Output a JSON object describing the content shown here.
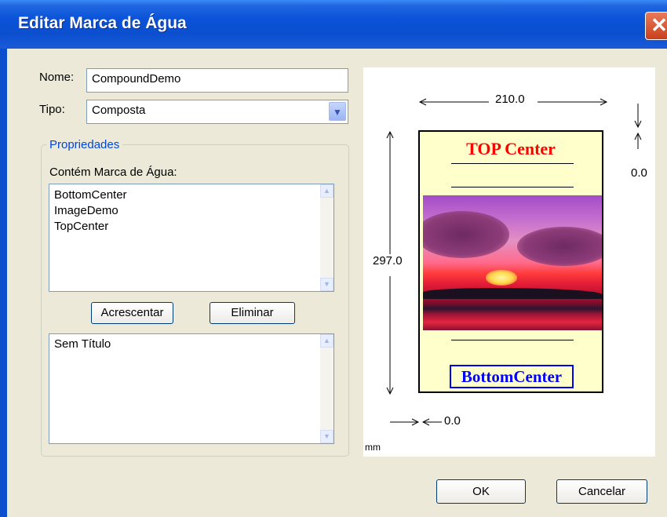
{
  "window": {
    "title": "Editar Marca de Água",
    "close_icon": "close-icon"
  },
  "form": {
    "nome_label": "Nome:",
    "nome_value": "CompoundDemo",
    "tipo_label": "Tipo:",
    "tipo_value": "Composta"
  },
  "properties": {
    "legend": "Propriedades",
    "contains_label": "Contém Marca de Água:",
    "watermarks": [
      "BottomCenter",
      "ImageDemo",
      "TopCenter"
    ],
    "add_button": "Acrescentar",
    "remove_button": "Eliminar",
    "detail_text": "Sem Título"
  },
  "preview": {
    "width_label": "210.0",
    "height_label": "297.0",
    "top_offset_label": "0.0",
    "left_offset_label": "0.0",
    "units_label": "mm",
    "top_text": "TOP Center",
    "bottom_text": "BottomCenter",
    "top_text_color": "#ff0000",
    "bottom_text_color": "#0000ff",
    "page_color": "#ffffcc"
  },
  "footer": {
    "ok_button": "OK",
    "cancel_button": "Cancelar"
  }
}
